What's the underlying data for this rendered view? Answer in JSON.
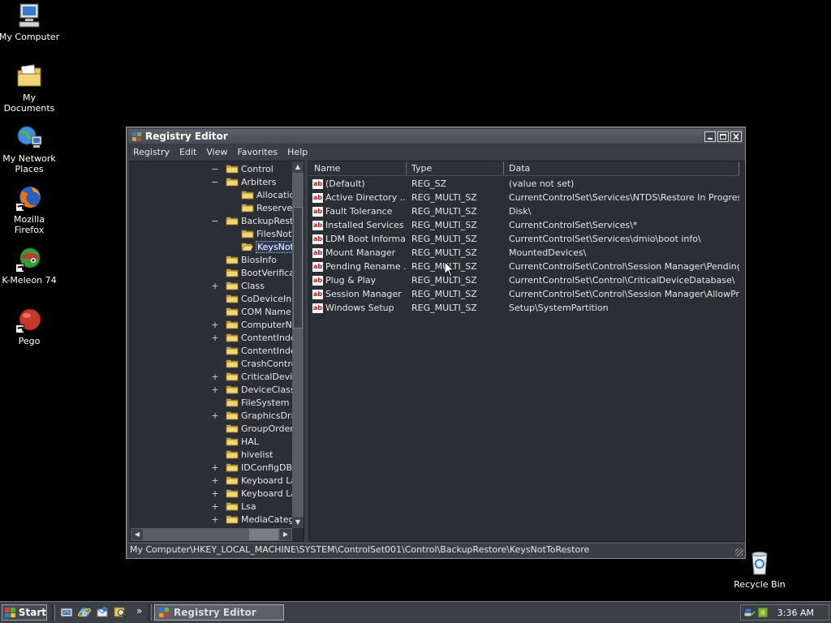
{
  "desktop": {
    "icons": [
      {
        "label": "My Computer"
      },
      {
        "label": "My Documents"
      },
      {
        "label": "My Network Places"
      },
      {
        "label": "Mozilla Firefox"
      },
      {
        "label": "K-Meleon 74"
      },
      {
        "label": "Pego"
      },
      {
        "label": "Recycle Bin"
      }
    ]
  },
  "window": {
    "title": "Registry Editor",
    "menu": [
      "Registry",
      "Edit",
      "View",
      "Favorites",
      "Help"
    ],
    "tree": [
      {
        "expander": "−",
        "label": "Control"
      },
      {
        "expander": "−",
        "label": "Arbiters"
      },
      {
        "expander": "",
        "label": "Allocation"
      },
      {
        "expander": "",
        "label": "Reserved"
      },
      {
        "expander": "−",
        "label": "BackupResto"
      },
      {
        "expander": "",
        "label": "FilesNotT"
      },
      {
        "expander": "",
        "label": "KeysNotT"
      },
      {
        "expander": "",
        "label": "BiosInfo"
      },
      {
        "expander": "",
        "label": "BootVerificat"
      },
      {
        "expander": "+",
        "label": "Class"
      },
      {
        "expander": "",
        "label": "CoDeviceInst"
      },
      {
        "expander": "",
        "label": "COM Name A"
      },
      {
        "expander": "+",
        "label": "ComputerNar"
      },
      {
        "expander": "+",
        "label": "ContentInde"
      },
      {
        "expander": "",
        "label": "ContentInde"
      },
      {
        "expander": "",
        "label": "CrashContro"
      },
      {
        "expander": "+",
        "label": "CriticalDevice"
      },
      {
        "expander": "+",
        "label": "DeviceClasse"
      },
      {
        "expander": "",
        "label": "FileSystem"
      },
      {
        "expander": "+",
        "label": "GraphicsDrive"
      },
      {
        "expander": "",
        "label": "GroupOrderL"
      },
      {
        "expander": "",
        "label": "HAL"
      },
      {
        "expander": "",
        "label": "hivelist"
      },
      {
        "expander": "+",
        "label": "IDConfigDB"
      },
      {
        "expander": "+",
        "label": "Keyboard Lay"
      },
      {
        "expander": "+",
        "label": "Keyboard Lay"
      },
      {
        "expander": "+",
        "label": "Lsa"
      },
      {
        "expander": "+",
        "label": "MediaCategc"
      }
    ],
    "columns": [
      "Name",
      "Type",
      "Data"
    ],
    "values": [
      {
        "name": "(Default)",
        "type": "REG_SZ",
        "data": "(value not set)"
      },
      {
        "name": "Active Directory ...",
        "type": "REG_MULTI_SZ",
        "data": "CurrentControlSet\\Services\\NTDS\\Restore In Progress..."
      },
      {
        "name": "Fault Tolerance",
        "type": "REG_MULTI_SZ",
        "data": "Disk\\"
      },
      {
        "name": "Installed Services",
        "type": "REG_MULTI_SZ",
        "data": "CurrentControlSet\\Services\\*"
      },
      {
        "name": "LDM Boot Informa...",
        "type": "REG_MULTI_SZ",
        "data": "CurrentControlSet\\Services\\dmio\\boot info\\"
      },
      {
        "name": "Mount Manager",
        "type": "REG_MULTI_SZ",
        "data": "MountedDevices\\"
      },
      {
        "name": "Pending Rename ...",
        "type": "REG_MULTI_SZ",
        "data": "CurrentControlSet\\Control\\Session Manager\\PendingFil..."
      },
      {
        "name": "Plug & Play",
        "type": "REG_MULTI_SZ",
        "data": "CurrentControlSet\\Control\\CriticalDeviceDatabase\\"
      },
      {
        "name": "Session Manager",
        "type": "REG_MULTI_SZ",
        "data": "CurrentControlSet\\Control\\Session Manager\\AllowProt..."
      },
      {
        "name": "Windows Setup",
        "type": "REG_MULTI_SZ",
        "data": "Setup\\SystemPartition"
      }
    ],
    "status_path": "My Computer\\HKEY_LOCAL_MACHINE\\SYSTEM\\ControlSet001\\Control\\BackupRestore\\KeysNotToRestore"
  },
  "taskbar": {
    "start_label": "Start",
    "task_label": "Registry Editor",
    "clock": "3:36 AM",
    "overflow": "»"
  },
  "colors": {
    "desktop": "#000000",
    "window_bg": "#3a3f46",
    "pane_bg": "#2b2f35",
    "taskbar": "#3b3f46",
    "selection": "#2b3b63"
  }
}
